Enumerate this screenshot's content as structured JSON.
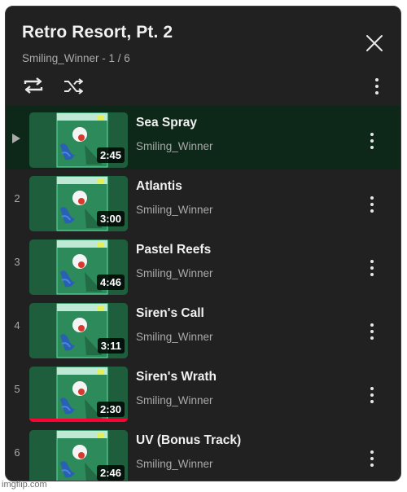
{
  "playlist": {
    "title": "Retro Resort, Pt. 2",
    "subtitle": "Smiling_Winner - 1 / 6"
  },
  "controls": {
    "icons": [
      "repeat-icon",
      "shuffle-icon",
      "more-vert-icon",
      "close-icon"
    ]
  },
  "colors": {
    "panel_bg": "#212121",
    "active_row_bg": "#0d2818",
    "progress": "#ff0033",
    "text_primary": "#f1f1f1",
    "text_secondary": "#aaaaaa"
  },
  "tracks": [
    {
      "index": "",
      "title": "Sea Spray",
      "artist": "Smiling_Winner",
      "duration": "2:45",
      "playing": true,
      "progress": 0
    },
    {
      "index": "2",
      "title": "Atlantis",
      "artist": "Smiling_Winner",
      "duration": "3:00",
      "playing": false,
      "progress": 0
    },
    {
      "index": "3",
      "title": "Pastel Reefs",
      "artist": "Smiling_Winner",
      "duration": "4:46",
      "playing": false,
      "progress": 0
    },
    {
      "index": "4",
      "title": "Siren's Call",
      "artist": "Smiling_Winner",
      "duration": "3:11",
      "playing": false,
      "progress": 0
    },
    {
      "index": "5",
      "title": "Siren's Wrath",
      "artist": "Smiling_Winner",
      "duration": "2:30",
      "playing": false,
      "progress": 1.0
    },
    {
      "index": "6",
      "title": "UV (Bonus Track)",
      "artist": "Smiling_Winner",
      "duration": "2:46",
      "playing": false,
      "progress": 0
    }
  ],
  "watermark": "imgflip.com"
}
